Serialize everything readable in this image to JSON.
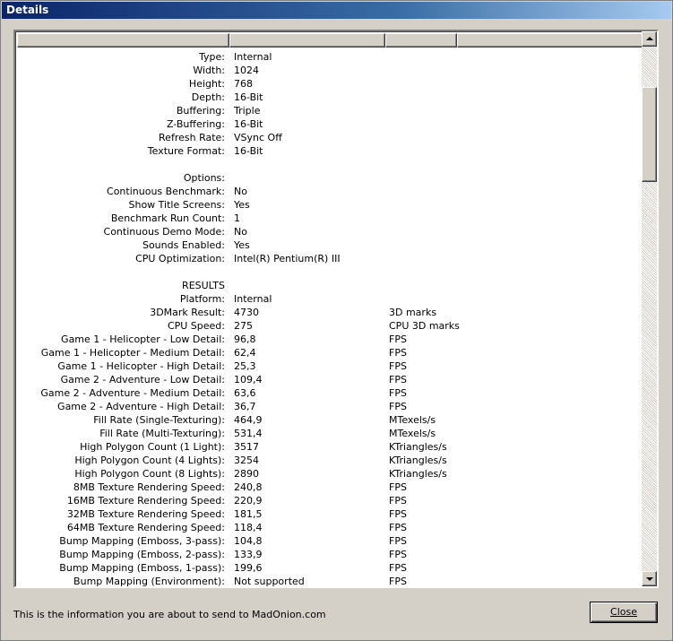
{
  "window": {
    "title": "Details"
  },
  "rows": [
    {
      "label": "Type:",
      "value": "Internal",
      "unit": ""
    },
    {
      "label": "Width:",
      "value": "1024",
      "unit": ""
    },
    {
      "label": "Height:",
      "value": "768",
      "unit": ""
    },
    {
      "label": "Depth:",
      "value": "16-Bit",
      "unit": ""
    },
    {
      "label": "Buffering:",
      "value": "Triple",
      "unit": ""
    },
    {
      "label": "Z-Buffering:",
      "value": "16-Bit",
      "unit": ""
    },
    {
      "label": "Refresh Rate:",
      "value": "VSync Off",
      "unit": ""
    },
    {
      "label": "Texture Format:",
      "value": "16-Bit",
      "unit": ""
    },
    {
      "label": "",
      "value": "",
      "unit": ""
    },
    {
      "label": "Options:",
      "value": "",
      "unit": ""
    },
    {
      "label": "Continuous Benchmark:",
      "value": "No",
      "unit": ""
    },
    {
      "label": "Show Title Screens:",
      "value": "Yes",
      "unit": ""
    },
    {
      "label": "Benchmark Run Count:",
      "value": "1",
      "unit": ""
    },
    {
      "label": "Continuous Demo Mode:",
      "value": "No",
      "unit": ""
    },
    {
      "label": "Sounds Enabled:",
      "value": "Yes",
      "unit": ""
    },
    {
      "label": "CPU Optimization:",
      "value": "Intel(R) Pentium(R) III",
      "unit": ""
    },
    {
      "label": "",
      "value": "",
      "unit": ""
    },
    {
      "label": "RESULTS",
      "value": "",
      "unit": ""
    },
    {
      "label": "Platform:",
      "value": "Internal",
      "unit": ""
    },
    {
      "label": "3DMark Result:",
      "value": "4730",
      "unit": "3D marks"
    },
    {
      "label": "CPU Speed:",
      "value": "275",
      "unit": "CPU 3D marks"
    },
    {
      "label": "Game 1 - Helicopter - Low Detail:",
      "value": "96,8",
      "unit": "FPS"
    },
    {
      "label": "Game 1 - Helicopter - Medium Detail:",
      "value": "62,4",
      "unit": "FPS"
    },
    {
      "label": "Game 1 - Helicopter - High Detail:",
      "value": "25,3",
      "unit": "FPS"
    },
    {
      "label": "Game 2 - Adventure - Low Detail:",
      "value": "109,4",
      "unit": "FPS"
    },
    {
      "label": "Game 2 - Adventure - Medium Detail:",
      "value": "63,6",
      "unit": "FPS"
    },
    {
      "label": "Game 2 - Adventure - High Detail:",
      "value": "36,7",
      "unit": "FPS"
    },
    {
      "label": "Fill Rate (Single-Texturing):",
      "value": "464,9",
      "unit": "MTexels/s"
    },
    {
      "label": "Fill Rate (Multi-Texturing):",
      "value": "531,4",
      "unit": "MTexels/s"
    },
    {
      "label": "High Polygon Count (1 Light):",
      "value": "3517",
      "unit": "KTriangles/s"
    },
    {
      "label": "High Polygon Count (4 Lights):",
      "value": "3254",
      "unit": "KTriangles/s"
    },
    {
      "label": "High Polygon Count (8 Lights):",
      "value": "2890",
      "unit": "KTriangles/s"
    },
    {
      "label": "8MB Texture Rendering Speed:",
      "value": "240,8",
      "unit": "FPS"
    },
    {
      "label": "16MB Texture Rendering Speed:",
      "value": "220,9",
      "unit": "FPS"
    },
    {
      "label": "32MB Texture Rendering Speed:",
      "value": "181,5",
      "unit": "FPS"
    },
    {
      "label": "64MB Texture Rendering Speed:",
      "value": "118,4",
      "unit": "FPS"
    },
    {
      "label": "Bump Mapping (Emboss, 3-pass):",
      "value": "104,8",
      "unit": "FPS"
    },
    {
      "label": "Bump Mapping (Emboss, 2-pass):",
      "value": "133,9",
      "unit": "FPS"
    },
    {
      "label": "Bump Mapping (Emboss, 1-pass):",
      "value": "199,6",
      "unit": "FPS"
    },
    {
      "label": "Bump Mapping (Environment):",
      "value": "Not supported",
      "unit": "FPS"
    }
  ],
  "footer": {
    "info_text": "This is the information you are about to send to MadOnion.com",
    "close_label": "Close"
  },
  "icons": {
    "scroll_up": "scroll-up-arrow-icon",
    "scroll_down": "scroll-down-arrow-icon"
  },
  "colors": {
    "titlebar_start": "#0a246a",
    "titlebar_end": "#a6caf0",
    "face": "#d4d0c8"
  }
}
